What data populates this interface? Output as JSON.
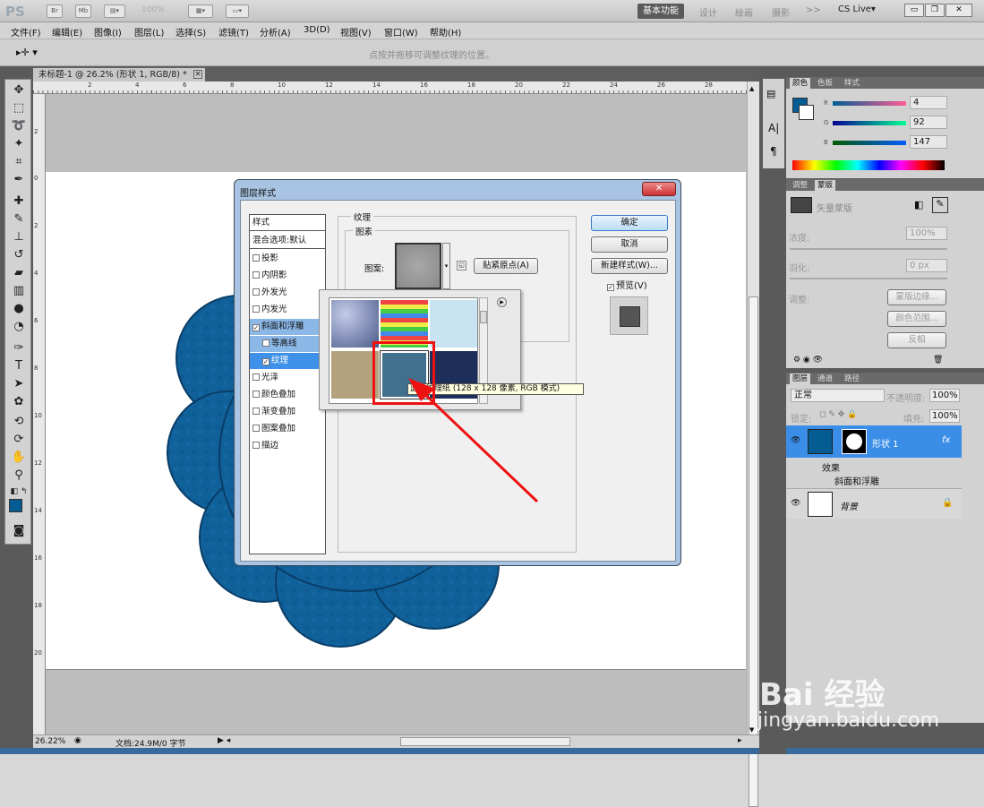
{
  "titlebar": {
    "logo": "PS",
    "zoom": "100%",
    "workspaces": [
      "基本功能",
      "设计",
      "绘画",
      "摄影",
      ">>"
    ],
    "cs_live": "CS Live▾"
  },
  "menu": [
    "文件(F)",
    "编辑(E)",
    "图像(I)",
    "图层(L)",
    "选择(S)",
    "滤镜(T)",
    "分析(A)",
    "3D(D)",
    "视图(V)",
    "窗口(W)",
    "帮助(H)"
  ],
  "options": {
    "hint": "点按并拖移可调整纹理的位置。"
  },
  "document": {
    "tab": "未标题-1 @ 26.2% (形状 1, RGB/8) *",
    "ruler_h": [
      "2",
      "4",
      "6",
      "8",
      "10",
      "12",
      "14",
      "16",
      "18",
      "20",
      "22",
      "24",
      "26",
      "28"
    ],
    "ruler_v": [
      "2",
      "0",
      "2",
      "4",
      "6",
      "8",
      "10",
      "12",
      "14",
      "16",
      "18",
      "20"
    ]
  },
  "status": {
    "zoom": "26.22%",
    "doc": "文档:24.9M/0 字节"
  },
  "dialog": {
    "title": "图层样式",
    "close": "✕",
    "styles_header": "样式",
    "blend": "混合选项:默认",
    "items": [
      "投影",
      "内阴影",
      "外发光",
      "内发光",
      "斜面和浮雕",
      "等高线",
      "纹理",
      "光泽",
      "颜色叠加",
      "渐变叠加",
      "图案叠加",
      "描边"
    ],
    "group_title": "纹理",
    "subgroup_title": "图素",
    "pattern_label": "图案:",
    "snap_button": "贴紧原点(A)",
    "ok": "确定",
    "cancel": "取消",
    "new_style": "新建样式(W)...",
    "preview": "预览(V)"
  },
  "tooltip": "蓝色纹理纸 (128 x 128 像素, RGB 模式)",
  "color_panel": {
    "tabs": [
      "颜色",
      "色板",
      "样式"
    ],
    "r": "4",
    "g": "92",
    "b": "147",
    "fg": "#045c93"
  },
  "mask_panel": {
    "tabs": [
      "调整",
      "蒙版"
    ],
    "title": "矢量蒙版",
    "density_label": "浓度:",
    "density": "100%",
    "feather_label": "羽化:",
    "feather": "0 px",
    "adjust_label": "调整:",
    "btn1": "蒙版边缘...",
    "btn2": "颜色范围...",
    "btn3": "反相"
  },
  "layers_panel": {
    "tabs": [
      "图层",
      "通道",
      "路径"
    ],
    "mode": "正常",
    "opacity_label": "不透明度:",
    "opacity": "100%",
    "lock_label": "锁定:",
    "fill_label": "填充:",
    "fill": "100%",
    "layer1": "形状 1",
    "fx": "fx",
    "effects": "效果",
    "effect1": "斜面和浮雕",
    "bg": "背景"
  },
  "watermark": {
    "brand": "Bai 经验",
    "url": "jingyan.baidu.com"
  }
}
